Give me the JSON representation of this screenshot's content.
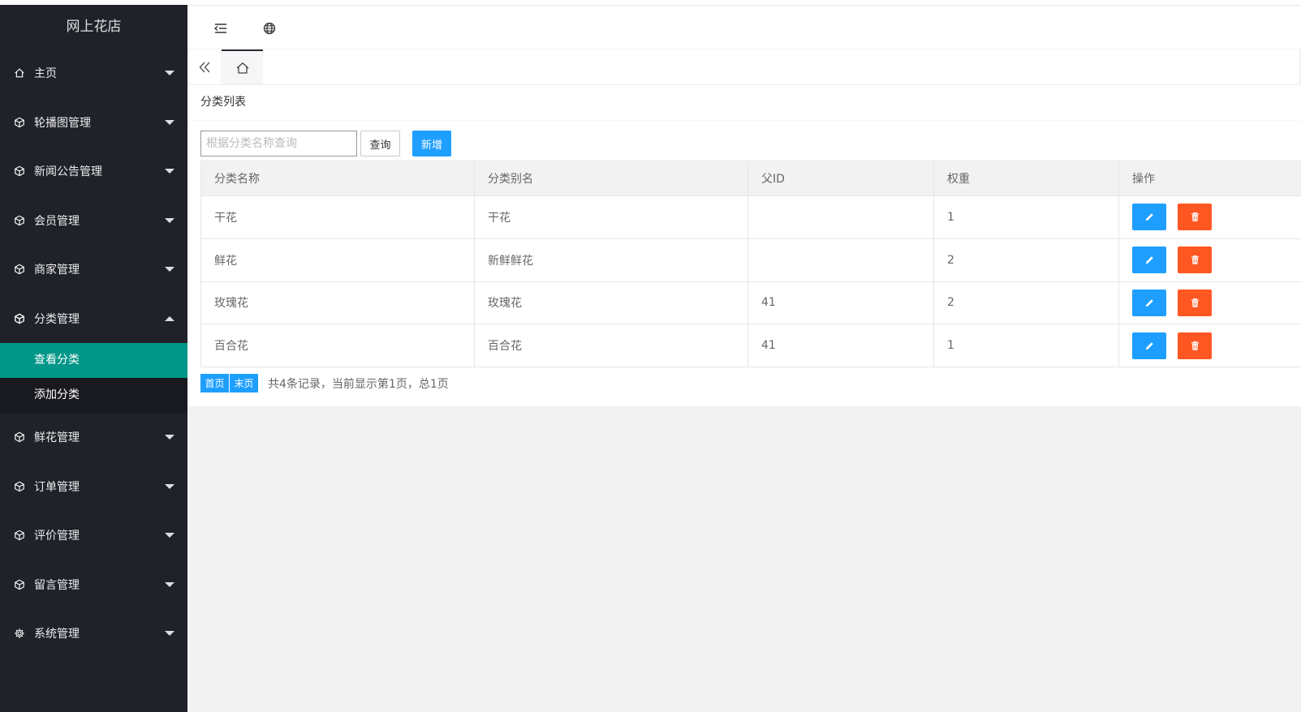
{
  "app": {
    "title": "网上花店"
  },
  "sidebar": {
    "items": [
      {
        "label": "主页",
        "icon": "home-icon"
      },
      {
        "label": "轮播图管理",
        "icon": "cube-icon"
      },
      {
        "label": "新闻公告管理",
        "icon": "cube-icon"
      },
      {
        "label": "会员管理",
        "icon": "cube-icon"
      },
      {
        "label": "商家管理",
        "icon": "cube-icon"
      },
      {
        "label": "分类管理",
        "icon": "cube-icon",
        "expanded": true
      },
      {
        "label": "鲜花管理",
        "icon": "cube-icon"
      },
      {
        "label": "订单管理",
        "icon": "cube-icon"
      },
      {
        "label": "评价管理",
        "icon": "cube-icon"
      },
      {
        "label": "留言管理",
        "icon": "cube-icon"
      },
      {
        "label": "系统管理",
        "icon": "gear-icon"
      }
    ],
    "children": [
      {
        "label": "查看分类",
        "active": true
      },
      {
        "label": "添加分类"
      }
    ]
  },
  "header": {
    "icons": [
      "indent-icon",
      "globe-icon"
    ]
  },
  "tabs": {
    "icons": [
      "double-chevron-left-icon",
      "home-icon"
    ]
  },
  "card": {
    "title": "分类列表"
  },
  "search": {
    "placeholder": "根据分类名称查询",
    "value": "",
    "query_label": "查询",
    "add_label": "新增"
  },
  "table": {
    "columns": [
      "分类名称",
      "分类别名",
      "父ID",
      "权重",
      "操作"
    ],
    "rows": [
      {
        "name": "干花",
        "alias": "干花",
        "parent_id": "",
        "weight": "1"
      },
      {
        "name": "鲜花",
        "alias": "新鲜鲜花",
        "parent_id": "",
        "weight": "2"
      },
      {
        "name": "玫瑰花",
        "alias": "玫瑰花",
        "parent_id": "41",
        "weight": "2"
      },
      {
        "name": "百合花",
        "alias": "百合花",
        "parent_id": "41",
        "weight": "1"
      }
    ]
  },
  "pager": {
    "first_label": "首页",
    "last_label": "末页",
    "info": "共4条记录，当前显示第1页，总1页"
  },
  "colors": {
    "sidebar_bg": "#20222a",
    "active_child": "#009688",
    "primary": "#1e9fff",
    "danger": "#ff5722"
  }
}
